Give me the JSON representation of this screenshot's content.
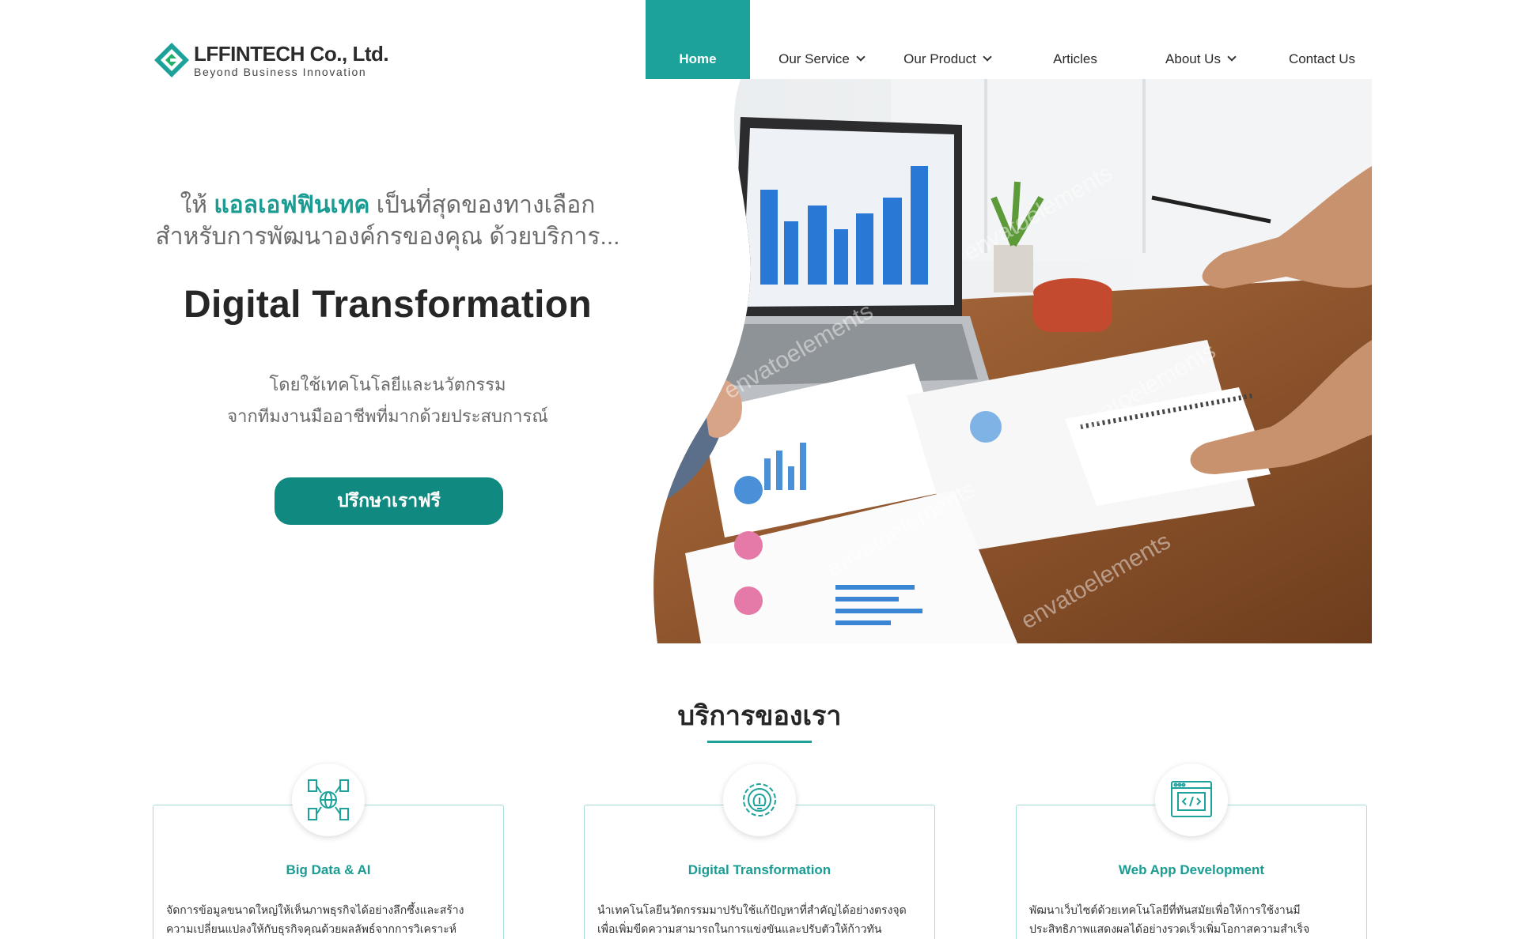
{
  "header": {
    "logo_name": "LFFINTECH Co., Ltd.",
    "logo_tagline": "Beyond Business Innovation",
    "nav": [
      {
        "label": "Home",
        "active": true
      },
      {
        "label": "Our Service",
        "dropdown": true
      },
      {
        "label": "Our Product",
        "dropdown": true
      },
      {
        "label": "Articles",
        "dropdown": false
      },
      {
        "label": "About Us",
        "dropdown": true
      },
      {
        "label": "Contact Us",
        "dropdown": false
      }
    ]
  },
  "hero": {
    "intro_prefix": "ให้ ",
    "intro_brand": "แอลเอฟฟินเทค",
    "intro_suffix": " เป็นที่สุดของทางเลือก",
    "intro_line2": "สำหรับการพัฒนาองค์กรของคุณ ด้วยบริการ...",
    "title": "Digital Transformation",
    "sub_line1": "โดยใช้เทคโนโลยีและนวัตกรรม",
    "sub_line2": "จากทีมงานมืออาชีพที่มากด้วยประสบการณ์",
    "cta": "ปรึกษาเราฟรี",
    "watermark": "envatoelements"
  },
  "services": {
    "title": "บริการของเรา",
    "cards": [
      {
        "title": "Big Data & AI",
        "icon": "big-data-ai-icon",
        "desc": "จัดการข้อมูลขนาดใหญ่ให้เห็นภาพธุรกิจได้อย่างลึกซึ้งและสร้างความเปลี่ยนแปลงให้กับธุรกิจคุณด้วยผลลัพธ์จากการวิเคราะห์"
      },
      {
        "title": "Digital Transformation",
        "icon": "digital-transformation-icon",
        "desc": "นำเทคโนโลยีนวัตกรรมมาปรับใช้แก้ปัญหาที่สำคัญได้อย่างตรงจุดเพื่อเพิ่มขีดความสามารถในการแข่งขันและปรับตัวให้ก้าวทัน"
      },
      {
        "title": "Web App Development",
        "icon": "web-app-icon",
        "desc": "พัฒนาเว็บไซต์ด้วยเทคโนโลยีที่ทันสมัยเพื่อให้การใช้งานมีประสิทธิภาพแสดงผลได้อย่างรวดเร็วเพิ่มโอกาสความสำเร็จ"
      }
    ]
  },
  "colors": {
    "accent": "#1ca29a",
    "button": "#108a80"
  }
}
